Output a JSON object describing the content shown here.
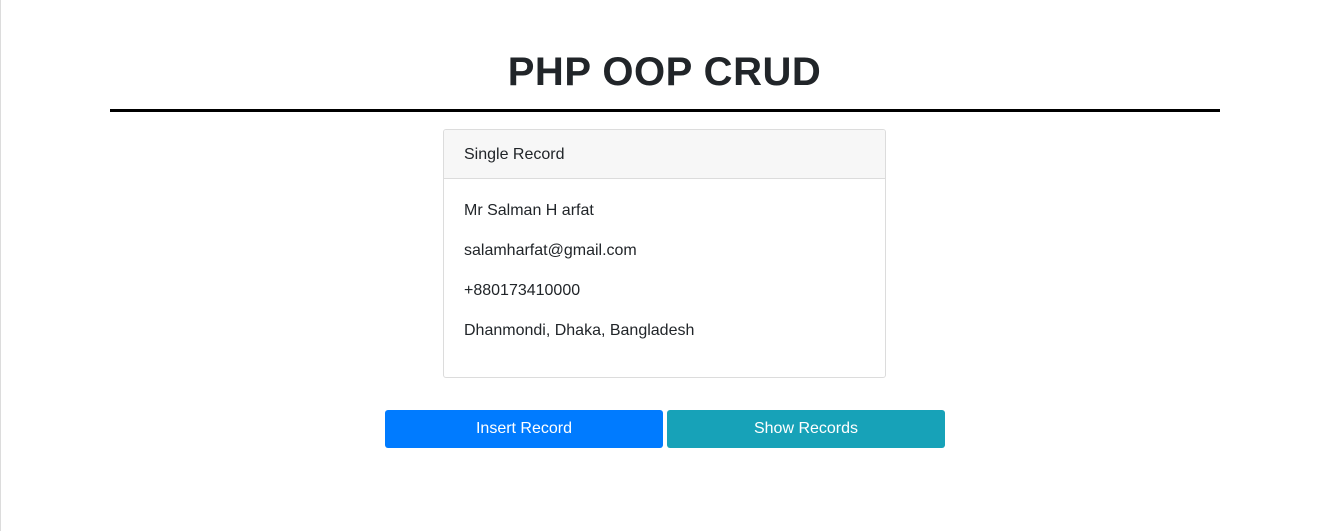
{
  "header": {
    "title": "PHP OOP CRUD"
  },
  "card": {
    "header": "Single Record",
    "name": "Mr Salman H arfat",
    "email": "salamharfat@gmail.com",
    "phone": "+880173410000",
    "address": "Dhanmondi, Dhaka, Bangladesh"
  },
  "actions": {
    "insert_label": "Insert Record",
    "show_label": "Show Records"
  },
  "colors": {
    "primary": "#007bff",
    "info": "#17a2b8",
    "text": "#212529",
    "card_header_bg": "#f7f7f7",
    "rule": "#000000"
  }
}
